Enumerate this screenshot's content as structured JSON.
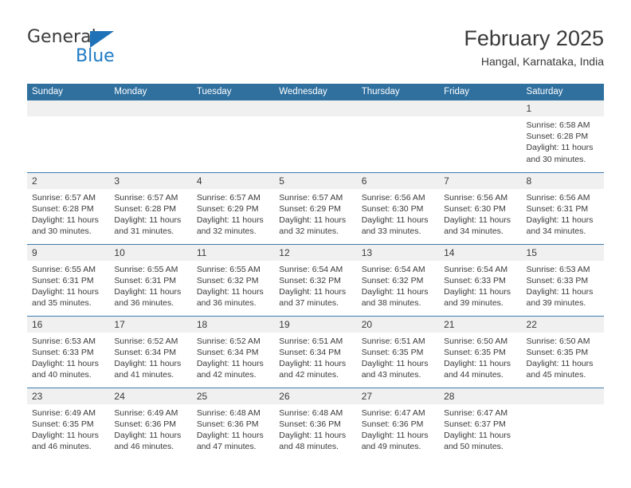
{
  "brand": {
    "name_part1": "General",
    "name_part2": "Blue",
    "triangle_icon": "triangle-icon",
    "accent_color": "#1f7bc4",
    "header_color": "#30709f"
  },
  "header": {
    "title": "February 2025",
    "location": "Hangal, Karnataka, India"
  },
  "calendar": {
    "weekday_headers": [
      "Sunday",
      "Monday",
      "Tuesday",
      "Wednesday",
      "Thursday",
      "Friday",
      "Saturday"
    ],
    "labels": {
      "sunrise": "Sunrise:",
      "sunset": "Sunset:",
      "daylight": "Daylight:"
    },
    "weeks": [
      [
        {
          "empty": true
        },
        {
          "empty": true
        },
        {
          "empty": true
        },
        {
          "empty": true
        },
        {
          "empty": true
        },
        {
          "empty": true
        },
        {
          "day": "1",
          "sunrise": "Sunrise: 6:58 AM",
          "sunset": "Sunset: 6:28 PM",
          "daylight": "Daylight: 11 hours and 30 minutes."
        }
      ],
      [
        {
          "day": "2",
          "sunrise": "Sunrise: 6:57 AM",
          "sunset": "Sunset: 6:28 PM",
          "daylight": "Daylight: 11 hours and 30 minutes."
        },
        {
          "day": "3",
          "sunrise": "Sunrise: 6:57 AM",
          "sunset": "Sunset: 6:28 PM",
          "daylight": "Daylight: 11 hours and 31 minutes."
        },
        {
          "day": "4",
          "sunrise": "Sunrise: 6:57 AM",
          "sunset": "Sunset: 6:29 PM",
          "daylight": "Daylight: 11 hours and 32 minutes."
        },
        {
          "day": "5",
          "sunrise": "Sunrise: 6:57 AM",
          "sunset": "Sunset: 6:29 PM",
          "daylight": "Daylight: 11 hours and 32 minutes."
        },
        {
          "day": "6",
          "sunrise": "Sunrise: 6:56 AM",
          "sunset": "Sunset: 6:30 PM",
          "daylight": "Daylight: 11 hours and 33 minutes."
        },
        {
          "day": "7",
          "sunrise": "Sunrise: 6:56 AM",
          "sunset": "Sunset: 6:30 PM",
          "daylight": "Daylight: 11 hours and 34 minutes."
        },
        {
          "day": "8",
          "sunrise": "Sunrise: 6:56 AM",
          "sunset": "Sunset: 6:31 PM",
          "daylight": "Daylight: 11 hours and 34 minutes."
        }
      ],
      [
        {
          "day": "9",
          "sunrise": "Sunrise: 6:55 AM",
          "sunset": "Sunset: 6:31 PM",
          "daylight": "Daylight: 11 hours and 35 minutes."
        },
        {
          "day": "10",
          "sunrise": "Sunrise: 6:55 AM",
          "sunset": "Sunset: 6:31 PM",
          "daylight": "Daylight: 11 hours and 36 minutes."
        },
        {
          "day": "11",
          "sunrise": "Sunrise: 6:55 AM",
          "sunset": "Sunset: 6:32 PM",
          "daylight": "Daylight: 11 hours and 36 minutes."
        },
        {
          "day": "12",
          "sunrise": "Sunrise: 6:54 AM",
          "sunset": "Sunset: 6:32 PM",
          "daylight": "Daylight: 11 hours and 37 minutes."
        },
        {
          "day": "13",
          "sunrise": "Sunrise: 6:54 AM",
          "sunset": "Sunset: 6:32 PM",
          "daylight": "Daylight: 11 hours and 38 minutes."
        },
        {
          "day": "14",
          "sunrise": "Sunrise: 6:54 AM",
          "sunset": "Sunset: 6:33 PM",
          "daylight": "Daylight: 11 hours and 39 minutes."
        },
        {
          "day": "15",
          "sunrise": "Sunrise: 6:53 AM",
          "sunset": "Sunset: 6:33 PM",
          "daylight": "Daylight: 11 hours and 39 minutes."
        }
      ],
      [
        {
          "day": "16",
          "sunrise": "Sunrise: 6:53 AM",
          "sunset": "Sunset: 6:33 PM",
          "daylight": "Daylight: 11 hours and 40 minutes."
        },
        {
          "day": "17",
          "sunrise": "Sunrise: 6:52 AM",
          "sunset": "Sunset: 6:34 PM",
          "daylight": "Daylight: 11 hours and 41 minutes."
        },
        {
          "day": "18",
          "sunrise": "Sunrise: 6:52 AM",
          "sunset": "Sunset: 6:34 PM",
          "daylight": "Daylight: 11 hours and 42 minutes."
        },
        {
          "day": "19",
          "sunrise": "Sunrise: 6:51 AM",
          "sunset": "Sunset: 6:34 PM",
          "daylight": "Daylight: 11 hours and 42 minutes."
        },
        {
          "day": "20",
          "sunrise": "Sunrise: 6:51 AM",
          "sunset": "Sunset: 6:35 PM",
          "daylight": "Daylight: 11 hours and 43 minutes."
        },
        {
          "day": "21",
          "sunrise": "Sunrise: 6:50 AM",
          "sunset": "Sunset: 6:35 PM",
          "daylight": "Daylight: 11 hours and 44 minutes."
        },
        {
          "day": "22",
          "sunrise": "Sunrise: 6:50 AM",
          "sunset": "Sunset: 6:35 PM",
          "daylight": "Daylight: 11 hours and 45 minutes."
        }
      ],
      [
        {
          "day": "23",
          "sunrise": "Sunrise: 6:49 AM",
          "sunset": "Sunset: 6:35 PM",
          "daylight": "Daylight: 11 hours and 46 minutes."
        },
        {
          "day": "24",
          "sunrise": "Sunrise: 6:49 AM",
          "sunset": "Sunset: 6:36 PM",
          "daylight": "Daylight: 11 hours and 46 minutes."
        },
        {
          "day": "25",
          "sunrise": "Sunrise: 6:48 AM",
          "sunset": "Sunset: 6:36 PM",
          "daylight": "Daylight: 11 hours and 47 minutes."
        },
        {
          "day": "26",
          "sunrise": "Sunrise: 6:48 AM",
          "sunset": "Sunset: 6:36 PM",
          "daylight": "Daylight: 11 hours and 48 minutes."
        },
        {
          "day": "27",
          "sunrise": "Sunrise: 6:47 AM",
          "sunset": "Sunset: 6:36 PM",
          "daylight": "Daylight: 11 hours and 49 minutes."
        },
        {
          "day": "28",
          "sunrise": "Sunrise: 6:47 AM",
          "sunset": "Sunset: 6:37 PM",
          "daylight": "Daylight: 11 hours and 50 minutes."
        },
        {
          "empty": true
        }
      ]
    ]
  }
}
